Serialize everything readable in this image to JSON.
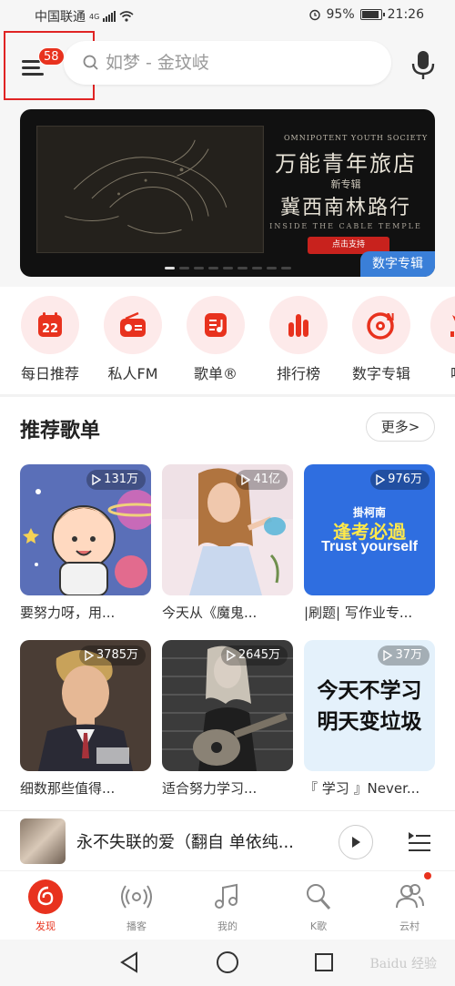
{
  "status": {
    "carrier": "中国联通",
    "network": "4G",
    "battery": "95%",
    "time": "21:26"
  },
  "header": {
    "badge_count": "58",
    "search_placeholder": "如梦 - 金玟岐",
    "icons": [
      "menu-icon",
      "search-icon",
      "mic-icon"
    ]
  },
  "banner": {
    "eyebrow": "OMNIPOTENT YOUTH SOCIETY",
    "band": "万能青年旅店",
    "subtitle": "新专辑",
    "album": "冀西南林路行",
    "english": "INSIDE THE CABLE TEMPLE",
    "cta": "点击支持",
    "tag": "数字专辑"
  },
  "quick_nav": [
    {
      "label": "每日推荐",
      "icon": "calendar-icon",
      "day": "22"
    },
    {
      "label": "私人FM",
      "icon": "radio-icon"
    },
    {
      "label": "歌单®",
      "icon": "playlist-icon"
    },
    {
      "label": "排行榜",
      "icon": "chart-icon"
    },
    {
      "label": "数字专辑",
      "icon": "album-icon"
    },
    {
      "label": "唱",
      "icon": "partial-icon"
    }
  ],
  "playlists": {
    "title": "推荐歌单",
    "more": "更多>",
    "items": [
      {
        "plays": "131万",
        "title": "要努力呀，用..."
      },
      {
        "plays": "41亿",
        "title": "今天从《魔鬼..."
      },
      {
        "plays": "976万",
        "title": "|刷题| 写作业专...",
        "cover_text_1": "掛柯南",
        "cover_text_2": "逢考必過",
        "cover_text_3": "Trust yourself"
      },
      {
        "plays": "3785万",
        "title": "细数那些值得..."
      },
      {
        "plays": "2645万",
        "title": "适合努力学习..."
      },
      {
        "plays": "37万",
        "title": "『 学习 』Never...",
        "cover_text_1": "今天不学习",
        "cover_text_2": "明天变垃圾"
      }
    ]
  },
  "player": {
    "title": "永不失联的爱（翻自 单依纯..."
  },
  "tabs": [
    {
      "label": "发现",
      "icon": "discover-icon",
      "active": true
    },
    {
      "label": "播客",
      "icon": "podcast-icon"
    },
    {
      "label": "我的",
      "icon": "music-note-icon"
    },
    {
      "label": "K歌",
      "icon": "karaoke-icon"
    },
    {
      "label": "云村",
      "icon": "community-icon"
    }
  ],
  "watermark": "Baidu 经验",
  "colors": {
    "accent": "#e8321e",
    "tag_blue": "#3a7fd8"
  }
}
